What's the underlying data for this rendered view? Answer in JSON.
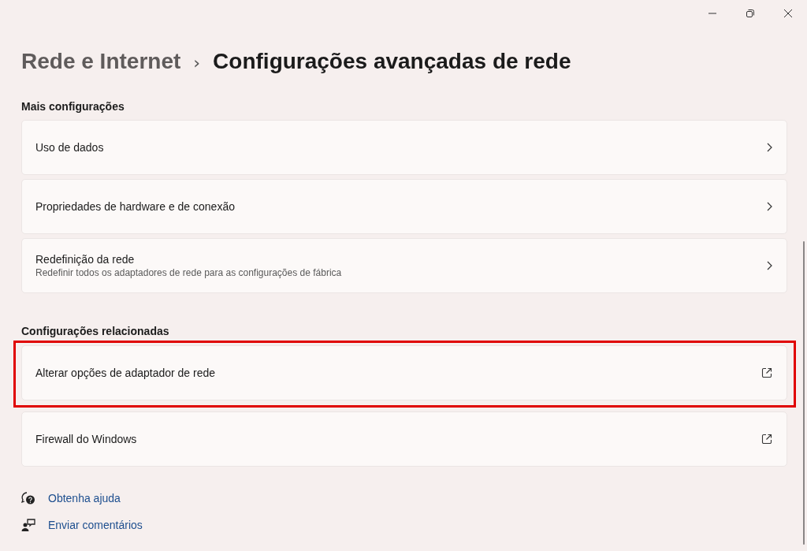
{
  "breadcrumb": {
    "parent": "Rede e Internet",
    "separator": "›",
    "current": "Configurações avançadas de rede"
  },
  "sections": [
    {
      "title": "Mais configurações",
      "items": [
        {
          "label": "Uso de dados",
          "kind": "chevron",
          "highlighted": false
        },
        {
          "label": "Propriedades de hardware e de conexão",
          "kind": "chevron",
          "highlighted": false
        },
        {
          "label": "Redefinição da rede",
          "description": "Redefinir todos os adaptadores de rede para as configurações de fábrica",
          "kind": "chevron",
          "highlighted": false
        }
      ]
    },
    {
      "title": "Configurações relacionadas",
      "items": [
        {
          "label": "Alterar opções de adaptador de rede",
          "kind": "external",
          "highlighted": true
        },
        {
          "label": "Firewall do Windows",
          "kind": "external",
          "highlighted": false
        }
      ]
    }
  ],
  "help_links": [
    {
      "label": "Obtenha ajuda",
      "kind": "help"
    },
    {
      "label": "Enviar comentários",
      "kind": "feedback"
    }
  ]
}
